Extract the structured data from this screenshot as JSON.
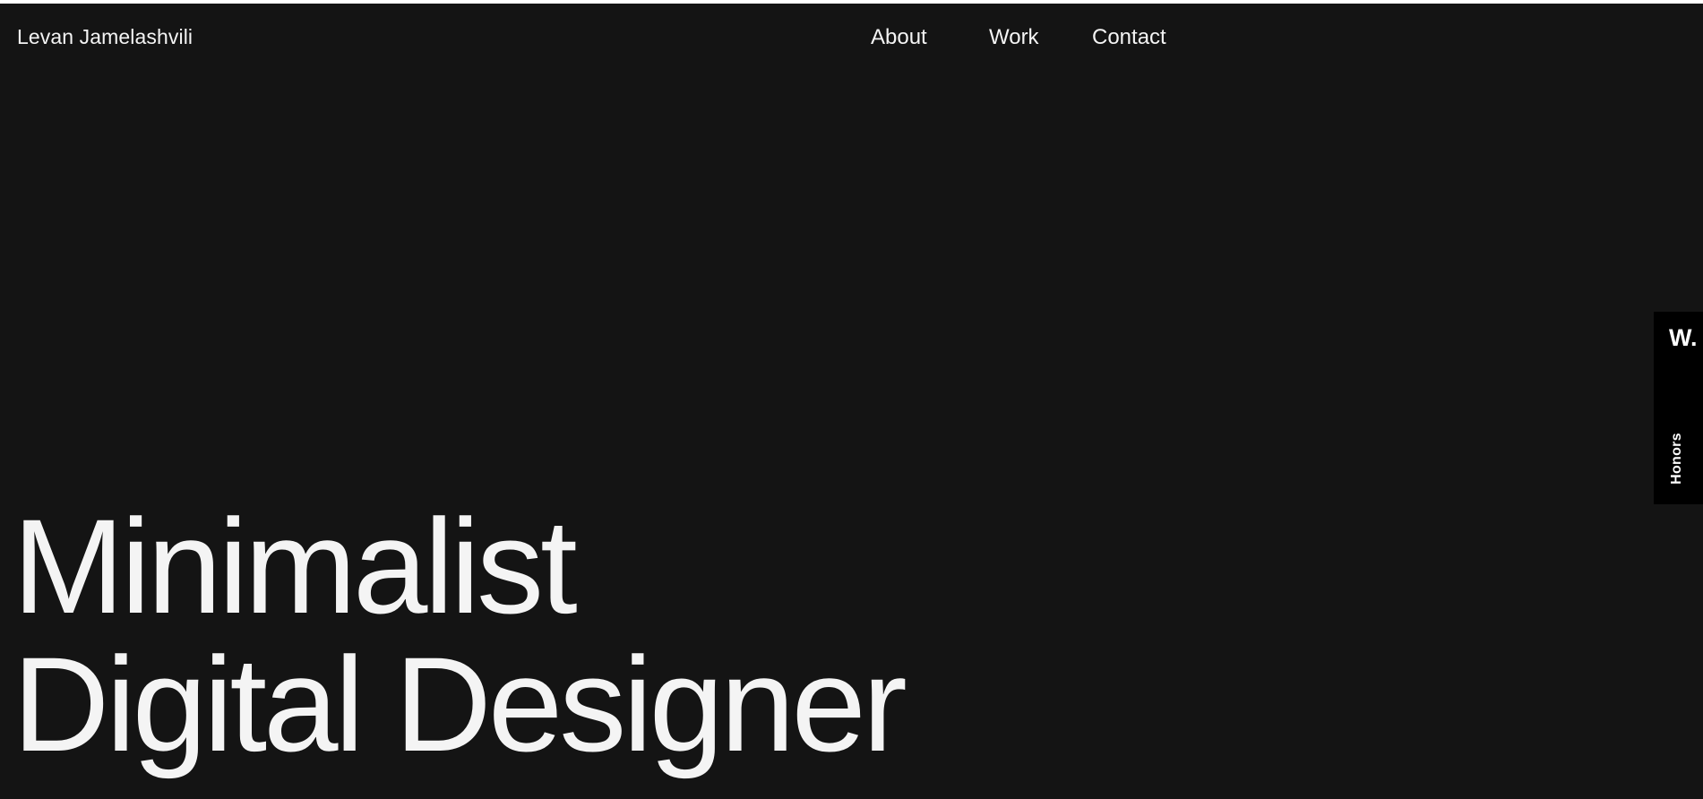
{
  "header": {
    "brand": "Levan Jamelashvili",
    "nav": {
      "about": "About",
      "work": "Work",
      "contact": "Contact"
    }
  },
  "hero": {
    "line1": "Minimalist",
    "line2": "Digital Designer"
  },
  "side_badge": {
    "logo": "W.",
    "label": "Honors"
  },
  "colors": {
    "background": "#141414",
    "text": "#f4f4f4",
    "badge": "#000000"
  }
}
